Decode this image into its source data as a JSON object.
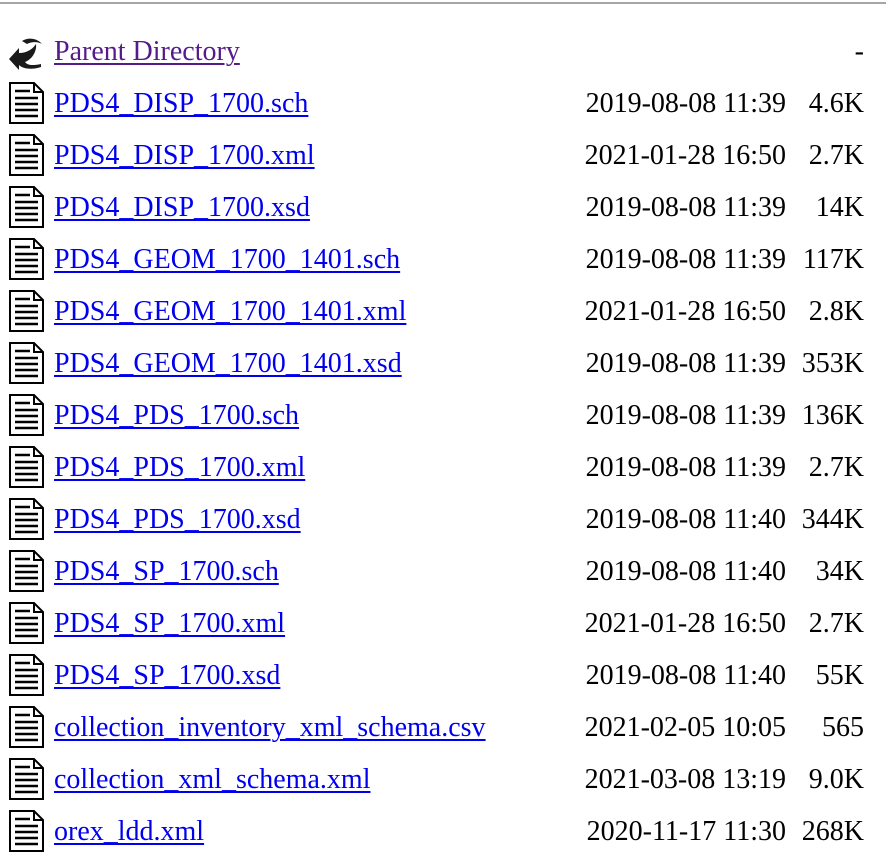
{
  "parent": {
    "label": "Parent Directory",
    "date": "",
    "size": "-",
    "icon": "back-arrow-icon"
  },
  "files": [
    {
      "name": "PDS4_DISP_1700.sch",
      "date": "2019-08-08 11:39",
      "size": "4.6K",
      "icon": "text-file-icon"
    },
    {
      "name": "PDS4_DISP_1700.xml",
      "date": "2021-01-28 16:50",
      "size": "2.7K",
      "icon": "text-file-icon"
    },
    {
      "name": "PDS4_DISP_1700.xsd",
      "date": "2019-08-08 11:39",
      "size": "14K",
      "icon": "text-file-icon"
    },
    {
      "name": "PDS4_GEOM_1700_1401.sch",
      "date": "2019-08-08 11:39",
      "size": "117K",
      "icon": "text-file-icon"
    },
    {
      "name": "PDS4_GEOM_1700_1401.xml",
      "date": "2021-01-28 16:50",
      "size": "2.8K",
      "icon": "text-file-icon"
    },
    {
      "name": "PDS4_GEOM_1700_1401.xsd",
      "date": "2019-08-08 11:39",
      "size": "353K",
      "icon": "text-file-icon"
    },
    {
      "name": "PDS4_PDS_1700.sch",
      "date": "2019-08-08 11:39",
      "size": "136K",
      "icon": "text-file-icon"
    },
    {
      "name": "PDS4_PDS_1700.xml",
      "date": "2019-08-08 11:39",
      "size": "2.7K",
      "icon": "text-file-icon"
    },
    {
      "name": "PDS4_PDS_1700.xsd",
      "date": "2019-08-08 11:40",
      "size": "344K",
      "icon": "text-file-icon"
    },
    {
      "name": "PDS4_SP_1700.sch",
      "date": "2019-08-08 11:40",
      "size": "34K",
      "icon": "text-file-icon"
    },
    {
      "name": "PDS4_SP_1700.xml",
      "date": "2021-01-28 16:50",
      "size": "2.7K",
      "icon": "text-file-icon"
    },
    {
      "name": "PDS4_SP_1700.xsd",
      "date": "2019-08-08 11:40",
      "size": "55K",
      "icon": "text-file-icon"
    },
    {
      "name": "collection_inventory_xml_schema.csv",
      "date": "2021-02-05 10:05",
      "size": "565",
      "icon": "text-file-icon"
    },
    {
      "name": "collection_xml_schema.xml",
      "date": "2021-03-08 13:19",
      "size": "9.0K",
      "icon": "text-file-icon"
    },
    {
      "name": "orex_ldd.xml",
      "date": "2020-11-17 11:30",
      "size": "268K",
      "icon": "text-file-icon"
    }
  ],
  "colors": {
    "link": "#0000ee",
    "visited_link": "#551a8b",
    "rule": "#a6a6a6"
  }
}
